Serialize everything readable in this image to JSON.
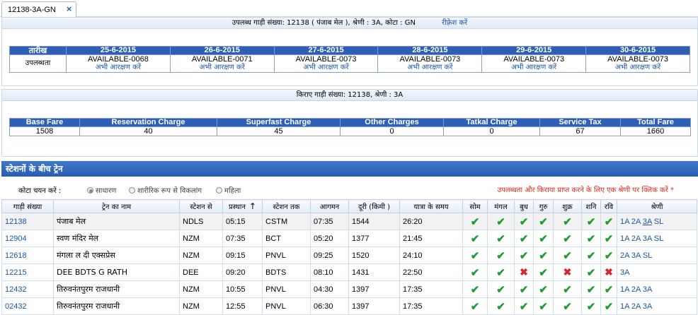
{
  "tab": {
    "label": "12138-3A-GN",
    "close": "×"
  },
  "availability": {
    "heading": "उपलब्ध गाड़ी संख्या: 12138 ( पंजाब मेल ), श्रेणी : 3A, कोटा : GN",
    "refresh": "रीफ़्रेश करें",
    "date_header": "तारीख",
    "row_label": "उपलब्धता",
    "book_label": "अभी आरक्षण करें",
    "dates": [
      {
        "date": "25-6-2015",
        "status": "AVAILABLE-0068"
      },
      {
        "date": "26-6-2015",
        "status": "AVAILABLE-0071"
      },
      {
        "date": "27-6-2015",
        "status": "AVAILABLE-0073"
      },
      {
        "date": "28-6-2015",
        "status": "AVAILABLE-0073"
      },
      {
        "date": "29-6-2015",
        "status": "AVAILABLE-0073"
      },
      {
        "date": "30-6-2015",
        "status": "AVAILABLE-0073"
      }
    ]
  },
  "fare": {
    "heading": "किराए गाड़ी संख्या: 12138, श्रेणी : 3A",
    "columns": [
      "Base Fare",
      "Reservation Charge",
      "Superfast Charge",
      "Other Charges",
      "Tatkal Charge",
      "Service Tax",
      "Total Fare"
    ],
    "values": [
      "1508",
      "40",
      "45",
      "0",
      "0",
      "67",
      "1660"
    ]
  },
  "trains_section": {
    "title": "स्टेशनों के बीच ट्रेन",
    "quota_label": "कोटा चयन करें :",
    "quota_options": [
      "साधारण",
      "शारीरिक रूप से विकलांग",
      "महिला"
    ],
    "hint": "उपलब्धता और किराया प्राप्त करने के लिए एक श्रेणी पर क्लिक करें *",
    "columns": [
      "गाड़ी संख्या",
      "ट्रेन का नाम",
      "स्टेशन से",
      "प्रस्थान",
      "स्टेशन तक",
      "आगमन",
      "दूरी (किमी )",
      "यात्रा के समय",
      "सोम",
      "मंगल",
      "बुध",
      "गुरु",
      "शुक्र",
      "शनि",
      "रवि",
      "श्रेणी"
    ],
    "sort_icon": "↑",
    "tick_glyph": "✔",
    "cross_glyph": "✖",
    "rows": [
      {
        "number": "12138",
        "name": "पंजाब मेल",
        "from": "NDLS",
        "dep": "05:15",
        "to": "CSTM",
        "arr": "07:35",
        "dist": "1544",
        "time": "26:20",
        "days": [
          1,
          1,
          1,
          1,
          1,
          1,
          1
        ],
        "classes": [
          "1A",
          "2A",
          "3A",
          "SL"
        ],
        "selected": "3A"
      },
      {
        "number": "12904",
        "name": "स्वण मंदिर मेल",
        "from": "NZM",
        "dep": "07:35",
        "to": "BCT",
        "arr": "05:20",
        "dist": "1377",
        "time": "21:45",
        "days": [
          1,
          1,
          1,
          1,
          1,
          1,
          1
        ],
        "classes": [
          "1A",
          "2A",
          "3A",
          "SL"
        ]
      },
      {
        "number": "12618",
        "name": "मंगला ल दी एक्सप्रेस",
        "from": "NZM",
        "dep": "09:15",
        "to": "PNVL",
        "arr": "09:25",
        "dist": "1520",
        "time": "24:10",
        "days": [
          1,
          1,
          1,
          1,
          1,
          1,
          1
        ],
        "classes": [
          "2A",
          "3A",
          "SL"
        ]
      },
      {
        "number": "12215",
        "name": "DEE BDTS G RATH",
        "from": "DEE",
        "dep": "09:20",
        "to": "BDTS",
        "arr": "08:10",
        "dist": "1431",
        "time": "22:50",
        "days": [
          1,
          1,
          0,
          1,
          0,
          1,
          0
        ],
        "classes": [
          "3A"
        ]
      },
      {
        "number": "12432",
        "name": "तिरुवनंतपुरम राजधानी",
        "from": "NZM",
        "dep": "10:55",
        "to": "PNVL",
        "arr": "04:30",
        "dist": "1397",
        "time": "17:35",
        "days": [
          1,
          1,
          1,
          1,
          1,
          1,
          1
        ],
        "classes": [
          "1A",
          "2A",
          "3A"
        ]
      },
      {
        "number": "02432",
        "name": "तिरुवनंतपुरम राजधानी",
        "from": "NZM",
        "dep": "12:55",
        "to": "PNVL",
        "arr": "06:30",
        "dist": "1397",
        "time": "17:35",
        "days": [
          1,
          1,
          1,
          1,
          1,
          1,
          1
        ],
        "classes": [
          "1A",
          "2A",
          "3A"
        ]
      }
    ]
  }
}
